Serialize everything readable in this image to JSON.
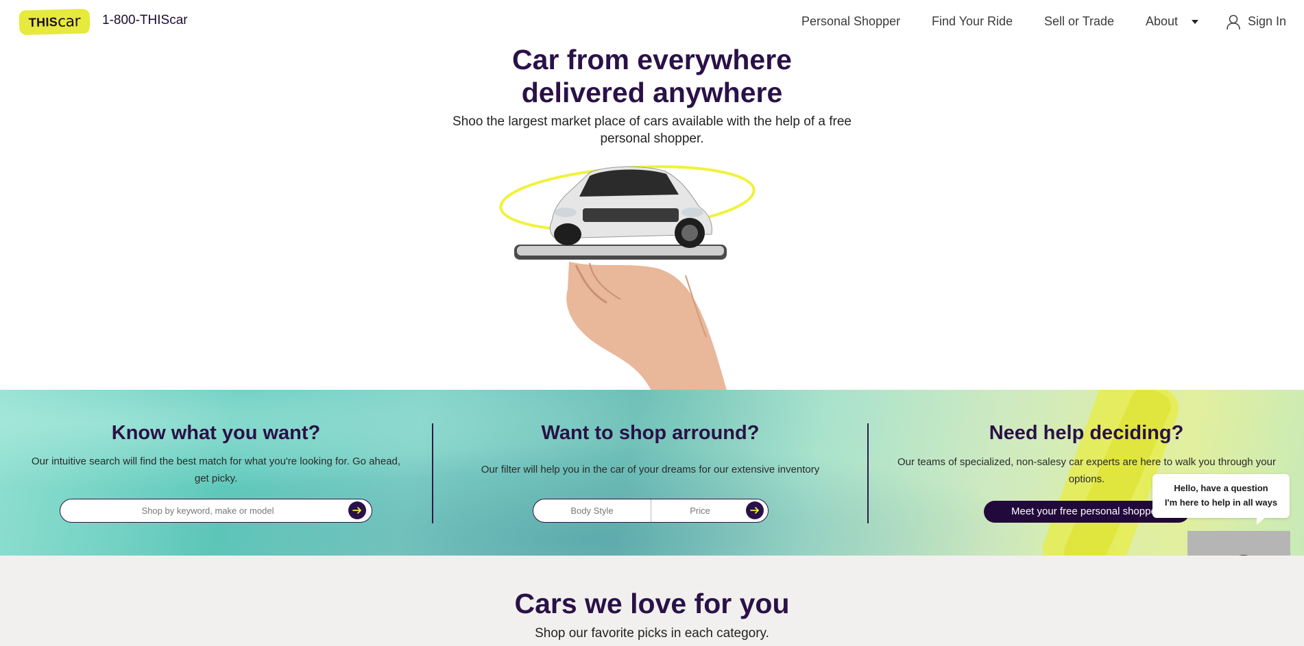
{
  "header": {
    "logo": {
      "this": "THIS",
      "car": "car"
    },
    "phone": "1-800-THIScar",
    "nav": [
      {
        "label": "Personal Shopper"
      },
      {
        "label": "Find Your Ride"
      },
      {
        "label": "Sell or Trade"
      },
      {
        "label": "About"
      }
    ],
    "sign_in": "Sign In"
  },
  "hero": {
    "title_line1": "Car from everywhere",
    "title_line2": "delivered anywhere",
    "subtitle_line1": "Shoo the largest market place of cars available with the help of a free",
    "subtitle_line2": "personal shopper."
  },
  "columns": {
    "know": {
      "title": "Know what you want?",
      "text_line1": "Our intuitive search will find the best match for what you're looking for. Go ahead,",
      "text_line2": "get picky.",
      "search_placeholder": "Shop by keyword, make or model"
    },
    "shop": {
      "title": "Want to shop arround?",
      "text": "Our filter will help you in the car of your dreams for our extensive inventory",
      "body_style": "Body Style",
      "price": "Price"
    },
    "help": {
      "title": "Need help deciding?",
      "text_line1": "Our teams of specialized, non-salesy car experts are here to walk you through your",
      "text_line2": "options.",
      "cta": "Meet your free personal shopper"
    }
  },
  "chat": {
    "line1": "Hello, have a question",
    "line2": "I'm here to help in all ways"
  },
  "favorites": {
    "title": "Cars we love for you",
    "subtitle": "Shop our favorite picks in each category."
  },
  "colors": {
    "brand_purple": "#2a1147",
    "brand_yellow": "#e6ea3c",
    "cta_dark": "#22093b"
  }
}
